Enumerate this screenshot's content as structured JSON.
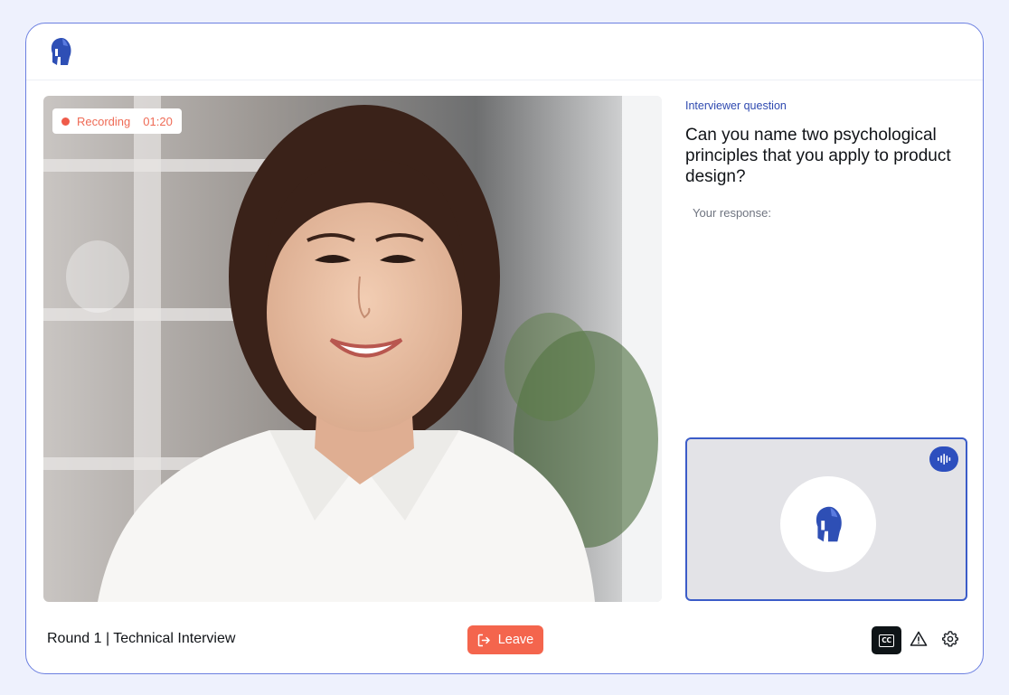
{
  "header": {
    "logo_icon": "spartan-helmet-logo"
  },
  "video": {
    "recording_label": "Recording",
    "recording_time": "01:20",
    "recording_color": "#ef5b4a"
  },
  "question": {
    "label": "Interviewer question",
    "text": "Can you name two psychological principles that you apply to product design?",
    "response_label": "Your response:"
  },
  "self_view": {
    "audio_icon": "audio-waveform-icon",
    "avatar_icon": "spartan-helmet-logo"
  },
  "footer": {
    "round_label": "Round 1 | Technical Interview",
    "leave_label": "Leave",
    "leave_icon": "exit-icon",
    "cc_label": "CC",
    "report_icon": "warning-icon",
    "settings_icon": "gear-icon"
  },
  "colors": {
    "accent": "#2d4fbe",
    "leave": "#f4654d",
    "frame_border": "#6b7fe0"
  }
}
